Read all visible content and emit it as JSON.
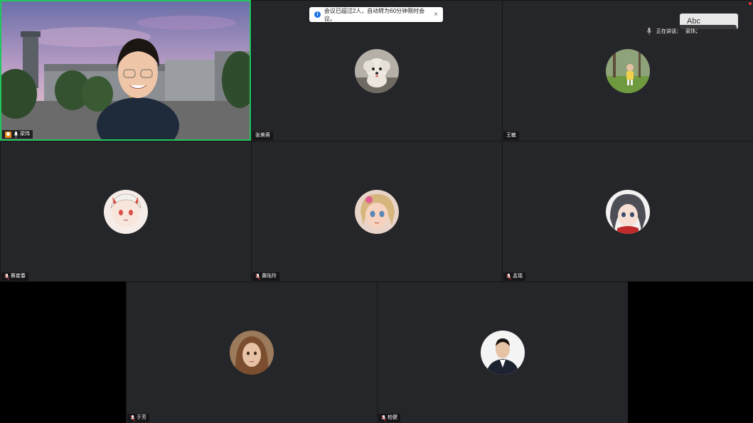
{
  "toast": {
    "message": "会议已超过2人，自动转为60分钟限时会议。",
    "close_icon": "×"
  },
  "speaking": {
    "label": "正在讲话：",
    "name": "梁玮；"
  },
  "floating_button": {
    "label": "Abc"
  },
  "participants": [
    {
      "name": "梁玮",
      "role": "host",
      "active": true
    },
    {
      "name": "张美蓉"
    },
    {
      "name": "王敏"
    },
    {
      "name": "蔡崔春"
    },
    {
      "name": "黄陆玲"
    },
    {
      "name": "孟瑶"
    },
    {
      "name": "于芳"
    },
    {
      "name": "柏健"
    }
  ],
  "colors": {
    "active_border": "#22c55e",
    "tile_bg": "#252629",
    "info_blue": "#1a73e8"
  }
}
